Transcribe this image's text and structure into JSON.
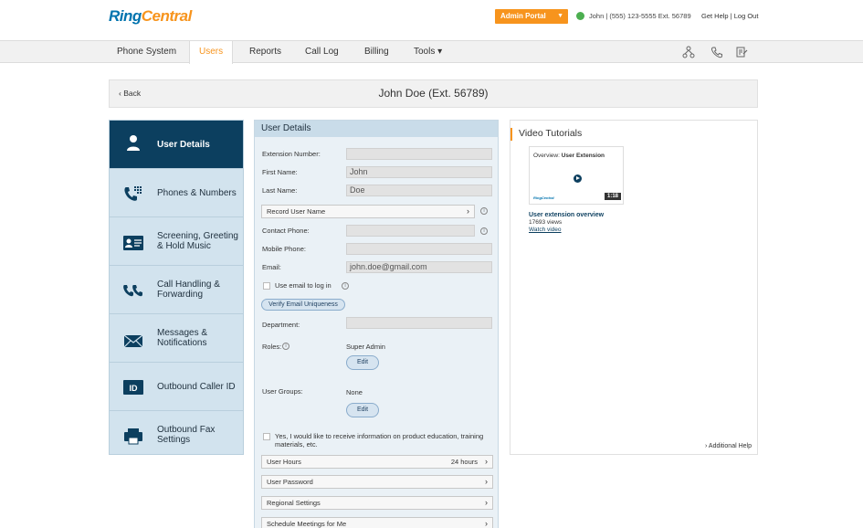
{
  "header": {
    "logo_ring": "Ring",
    "logo_central": "Central",
    "admin_portal": "Admin Portal",
    "user_info": "John | (555) 123-5555 Ext. 56789",
    "get_help": "Get Help",
    "separator": "|",
    "log_out": "Log Out"
  },
  "nav": {
    "phone_system": "Phone System",
    "users": "Users",
    "reports": "Reports",
    "call_log": "Call Log",
    "billing": "Billing",
    "tools": "Tools ▾"
  },
  "page": {
    "back": "‹ Back",
    "title": "John Doe (Ext. 56789)"
  },
  "sidebar": {
    "items": [
      {
        "label": "User Details"
      },
      {
        "label": "Phones & Numbers"
      },
      {
        "label": "Screening, Greeting & Hold Music"
      },
      {
        "label": "Call Handling & Forwarding"
      },
      {
        "label": "Messages & Notifications"
      },
      {
        "label": "Outbound Caller ID"
      },
      {
        "label": "Outbound Fax Settings"
      }
    ]
  },
  "form": {
    "title": "User Details",
    "extension_label": "Extension Number:",
    "extension_value": "",
    "first_name_label": "First Name:",
    "first_name_value": "John",
    "last_name_label": "Last Name:",
    "last_name_value": "Doe",
    "record_user_name": "Record User Name",
    "contact_phone_label": "Contact Phone:",
    "contact_phone_value": "",
    "mobile_phone_label": "Mobile Phone:",
    "mobile_phone_value": "",
    "email_label": "Email:",
    "email_value": "john.doe@gmail.com",
    "use_email_login": "Use email to log in",
    "verify_email": "Verify Email Uniqueness",
    "department_label": "Department:",
    "department_value": "",
    "roles_label": "Roles:",
    "roles_value": "Super Admin",
    "edit": "Edit",
    "user_groups_label": "User Groups:",
    "user_groups_value": "None",
    "opt_in": "Yes, I would like to receive information on product education, training materials, etc.",
    "user_hours": "User Hours",
    "user_hours_value": "24 hours",
    "user_password": "User Password",
    "regional_settings": "Regional Settings",
    "schedule_meetings": "Schedule Meetings for Me",
    "info_glyph": "i",
    "chevron": "›"
  },
  "video": {
    "title": "Video Tutorials",
    "thumb_caption_prefix": "Overview: ",
    "thumb_caption_bold": "User Extension",
    "thumb_logo": "RingCentral",
    "duration": "1:18",
    "name": "User extension overview",
    "views": "17693 views",
    "watch": "Watch video",
    "additional_help": "› Additional Help"
  },
  "colors": {
    "brand_orange": "#f7941d",
    "brand_blue": "#0073ae",
    "sidebar_active": "#0c3f5f",
    "sidebar_bg": "#d2e3ee"
  }
}
